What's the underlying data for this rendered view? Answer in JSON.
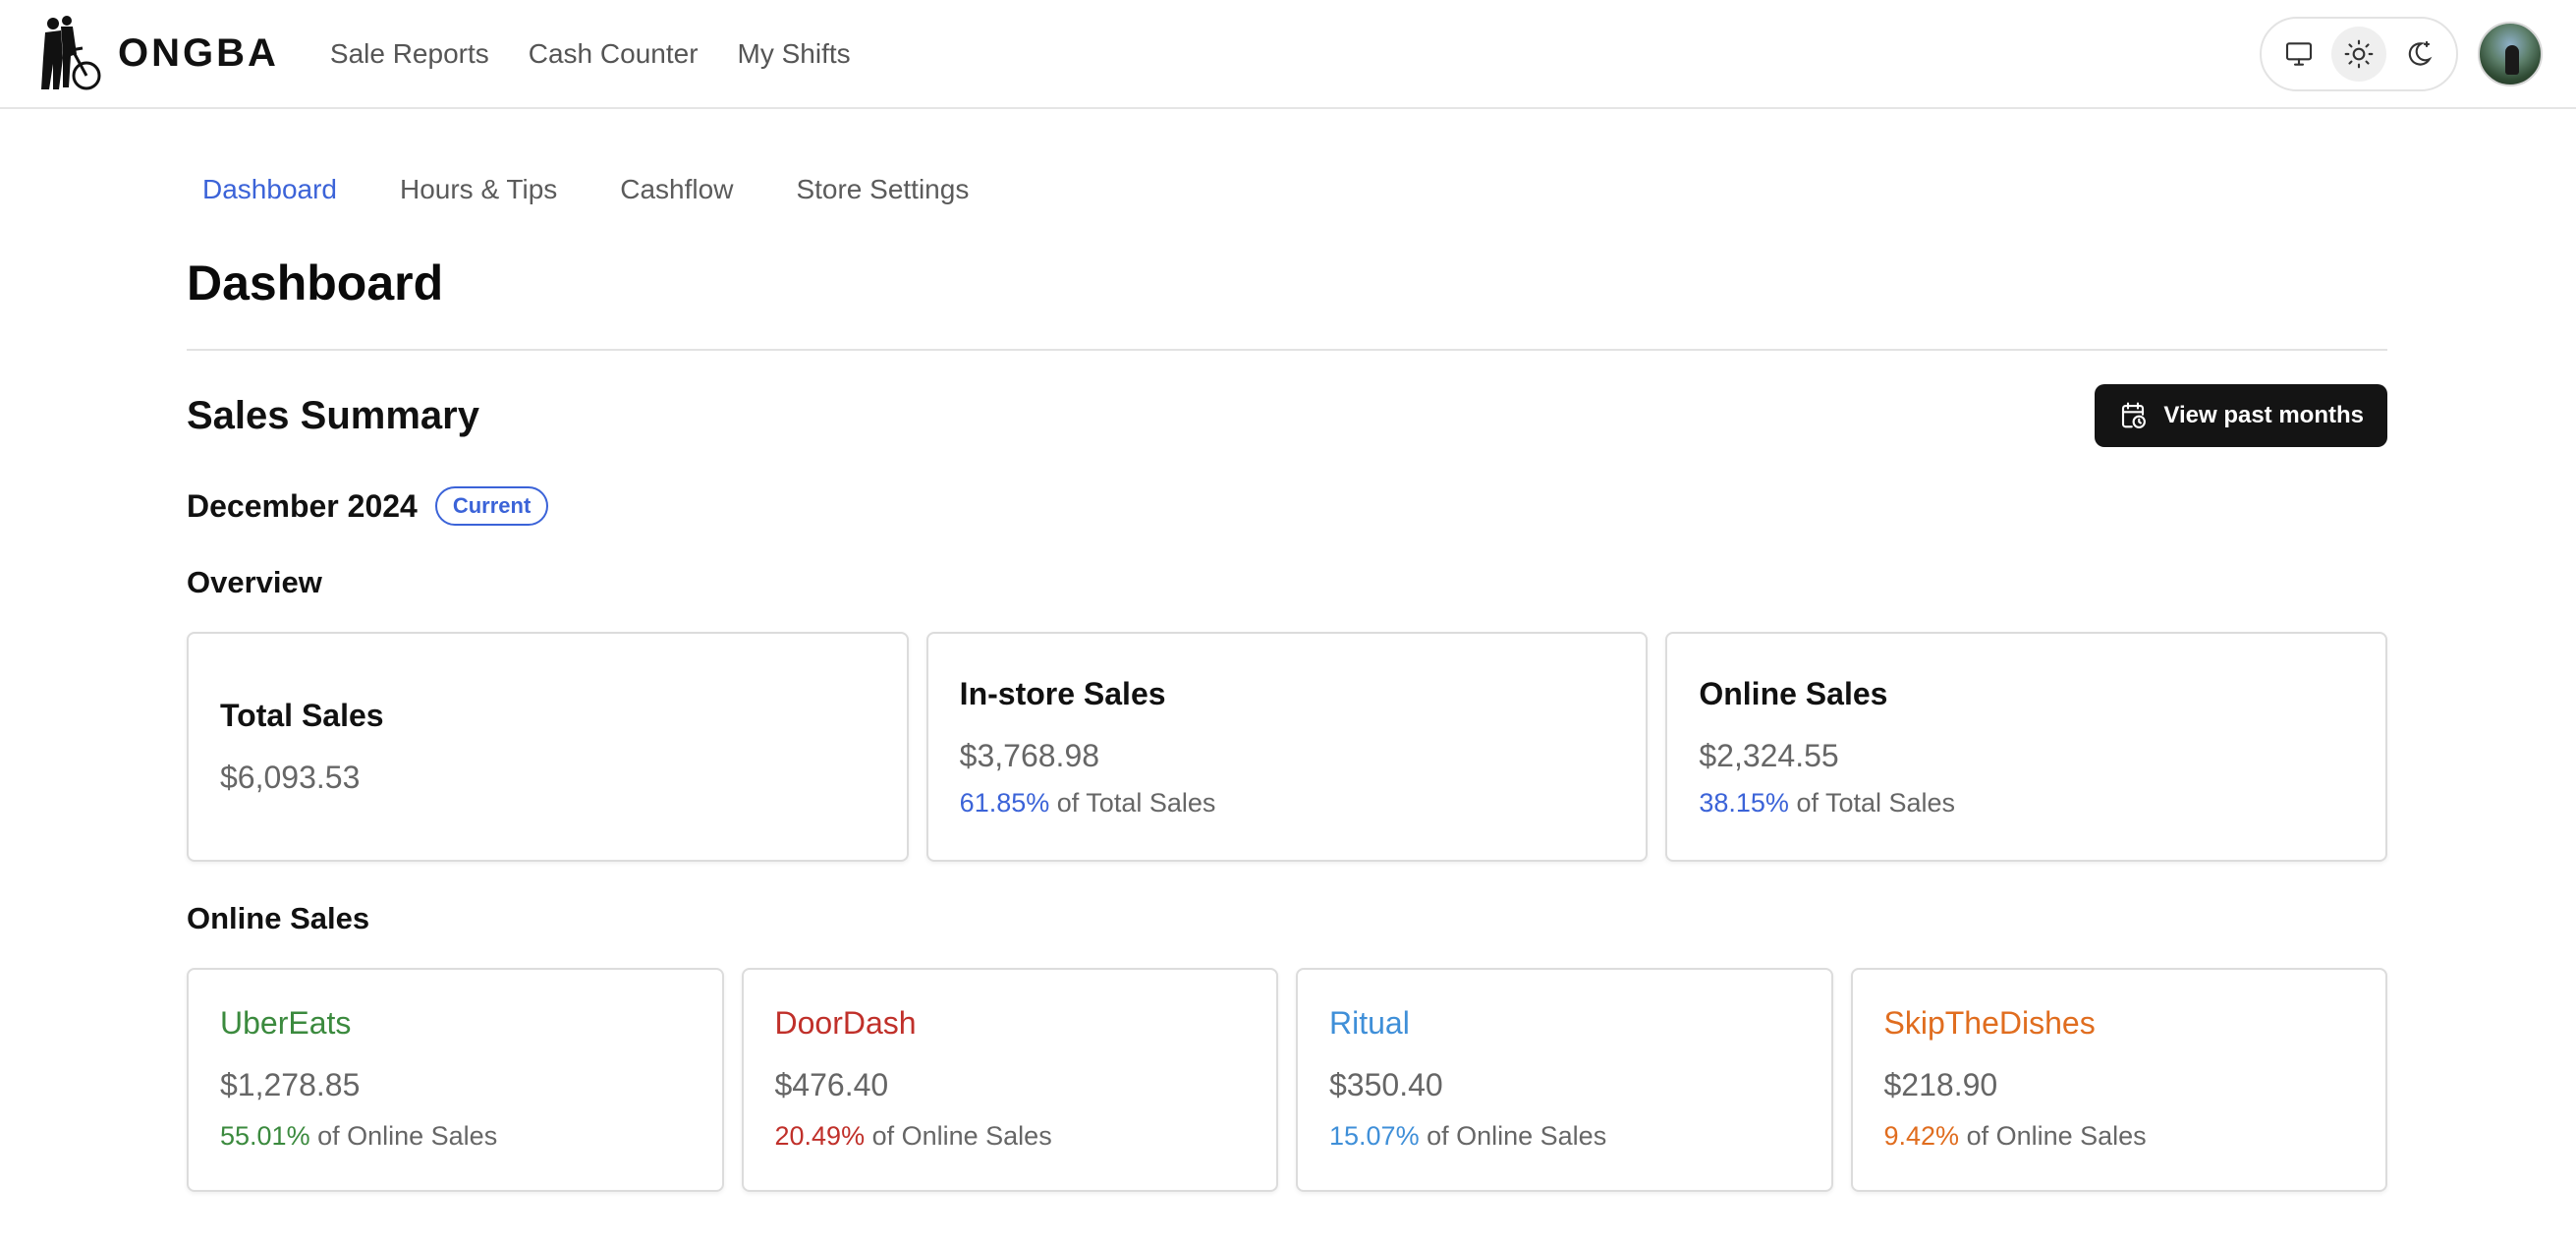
{
  "brand": {
    "name": "ONGBA"
  },
  "topnav": {
    "items": [
      "Sale Reports",
      "Cash Counter",
      "My Shifts"
    ]
  },
  "theme_switch": {
    "options": [
      "monitor-icon",
      "sun-icon",
      "moon-icon"
    ],
    "active": "sun-icon"
  },
  "subnav": {
    "items": [
      "Dashboard",
      "Hours & Tips",
      "Cashflow",
      "Store Settings"
    ],
    "active": "Dashboard"
  },
  "page": {
    "title": "Dashboard"
  },
  "sales_summary": {
    "title": "Sales Summary",
    "past_button_label": "View past months",
    "month": "December 2024",
    "badge": "Current",
    "overview": {
      "title": "Overview",
      "total": {
        "title": "Total Sales",
        "value": "$6,093.53"
      },
      "instore": {
        "title": "In-store Sales",
        "value": "$3,768.98",
        "pct": "61.85%",
        "pct_suffix": "of Total Sales"
      },
      "online": {
        "title": "Online Sales",
        "value": "$2,324.55",
        "pct": "38.15%",
        "pct_suffix": "of Total Sales"
      }
    },
    "online_sales": {
      "title": "Online Sales",
      "platforms": [
        {
          "name": "UberEats",
          "value": "$1,278.85",
          "pct": "55.01%",
          "pct_suffix": "of Online Sales",
          "color": "#3b8a3e"
        },
        {
          "name": "DoorDash",
          "value": "$476.40",
          "pct": "20.49%",
          "pct_suffix": "of Online Sales",
          "color": "#c0302a"
        },
        {
          "name": "Ritual",
          "value": "$350.40",
          "pct": "15.07%",
          "pct_suffix": "of Online Sales",
          "color": "#3f8fd8"
        },
        {
          "name": "SkipTheDishes",
          "value": "$218.90",
          "pct": "9.42%",
          "pct_suffix": "of Online Sales",
          "color": "#e06d1f"
        }
      ]
    }
  },
  "colors": {
    "accent": "#3b63d8",
    "button_dark": "#141414"
  }
}
